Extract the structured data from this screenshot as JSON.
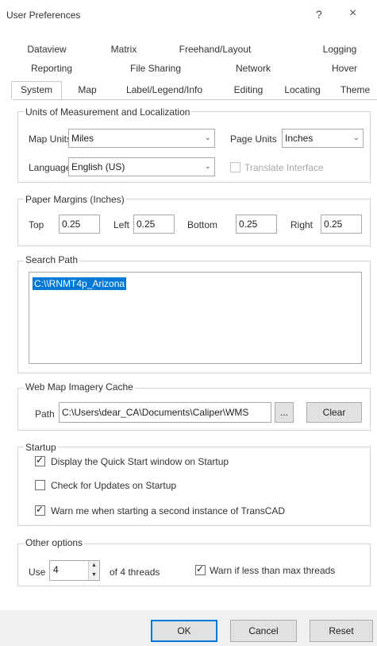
{
  "window": {
    "title": "User Preferences",
    "help_icon": "?",
    "close_icon": "×"
  },
  "tabs": {
    "row1": [
      "Dataview",
      "Matrix",
      "Freehand/Layout",
      "Logging"
    ],
    "row2": [
      "Reporting",
      "File Sharing",
      "Network",
      "Hover"
    ],
    "row3": [
      "System",
      "Map",
      "Label/Legend/Info",
      "Editing",
      "Locating",
      "Theme"
    ],
    "active": "System"
  },
  "units": {
    "title": "Units of Measurement and Localization",
    "map_units_label": "Map Units",
    "map_units_value": "Miles",
    "page_units_label": "Page Units",
    "page_units_value": "Inches",
    "language_label": "Language",
    "language_value": "English (US)",
    "translate_label": "Translate Interface",
    "translate_checked": false
  },
  "margins": {
    "title": "Paper Margins (Inches)",
    "top_label": "Top",
    "top_value": "0.25",
    "left_label": "Left",
    "left_value": "0.25",
    "bottom_label": "Bottom",
    "bottom_value": "0.25",
    "right_label": "Right",
    "right_value": "0.25"
  },
  "search_path": {
    "title": "Search Path",
    "items": [
      "C:\\\\RNMT4p_Arizona"
    ]
  },
  "cache": {
    "title": "Web Map Imagery Cache",
    "path_label": "Path",
    "path_value": "C:\\Users\\dear_CA\\Documents\\Caliper\\WMS",
    "browse_label": "...",
    "clear_label": "Clear"
  },
  "startup": {
    "title": "Startup",
    "options": [
      {
        "label": "Display the Quick Start window on Startup",
        "checked": true
      },
      {
        "label": "Check for Updates on Startup",
        "checked": false
      },
      {
        "label": "Warn me when starting a second instance of TransCAD",
        "checked": true
      }
    ]
  },
  "other": {
    "title": "Other options",
    "use_label": "Use",
    "threads_value": "4",
    "of_threads_label": "of 4 threads",
    "warn_label": "Warn if less than max threads",
    "warn_checked": true
  },
  "buttons": {
    "ok": "OK",
    "cancel": "Cancel",
    "reset": "Reset"
  }
}
